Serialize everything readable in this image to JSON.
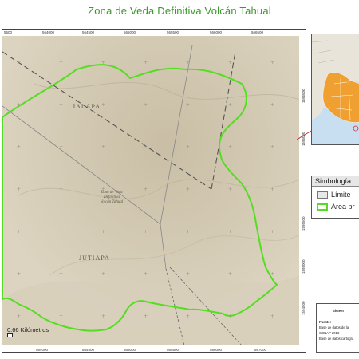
{
  "title": "Zona de Veda Definitiva Volcán Tahual",
  "map": {
    "municipalities": [
      "JALAPA",
      "JUTIAPA"
    ],
    "protected_area_label": [
      "Zona de Veda",
      "Definitiva",
      "Volcán Tahual"
    ],
    "x_ticks": [
      "5500",
      "564000",
      "564500",
      "565000",
      "565500",
      "566000",
      "566500",
      "567000"
    ],
    "y_ticks": [
      "1596500",
      "1596000",
      "1595500",
      "1595000",
      "1594500"
    ],
    "grid_marker": "+"
  },
  "scale": {
    "label": "0.66 Kilómetros"
  },
  "legend": {
    "title": "Simbología",
    "items": [
      {
        "label": "Límite",
        "fill": "#e8e8e8",
        "stroke": "#777777"
      },
      {
        "label": "Área pr",
        "fill": "#ffffff",
        "stroke": "#55dd22"
      }
    ]
  },
  "info": {
    "heading": "Sistem",
    "source_label": "Fuente:",
    "lines": [
      "Base de datos de la",
      "CONAP 2016",
      "Base de datos cartogra"
    ]
  },
  "colors": {
    "title": "#3a9a2a",
    "boundary": "#55dd22",
    "terrain": "#d4cbb6",
    "inset_region": "#f0a030"
  }
}
